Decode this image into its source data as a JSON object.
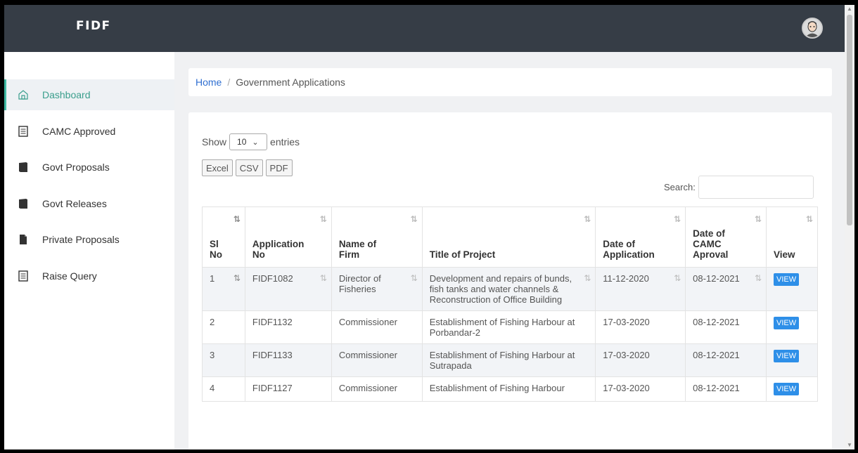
{
  "app": {
    "brand": "FIDF"
  },
  "sidebar": {
    "items": [
      {
        "label": "Dashboard",
        "icon": "home-icon",
        "active": true
      },
      {
        "label": "CAMC Approved",
        "icon": "list-icon"
      },
      {
        "label": "Govt Proposals",
        "icon": "book-icon"
      },
      {
        "label": "Govt Releases",
        "icon": "book-icon"
      },
      {
        "label": "Private Proposals",
        "icon": "file-icon"
      },
      {
        "label": "Raise Query",
        "icon": "list-icon"
      }
    ]
  },
  "breadcrumb": {
    "home": "Home",
    "separator": "/",
    "current": "Government Applications"
  },
  "table_controls": {
    "show_label": "Show",
    "entries_value": "10",
    "entries_label": "entries",
    "buttons": [
      "Excel",
      "CSV",
      "PDF"
    ],
    "search_label": "Search:",
    "search_value": ""
  },
  "table": {
    "headers": [
      {
        "l1": "Sl",
        "l2": "No"
      },
      {
        "l1": "Application",
        "l2": "No"
      },
      {
        "l1": "Name of",
        "l2": "Firm"
      },
      {
        "l1": "",
        "l2": "Title of Project"
      },
      {
        "l1": "Date of",
        "l2": "Application"
      },
      {
        "l1": "Date of",
        "l1b": "CAMC",
        "l2": "Aproval"
      },
      {
        "l1": "",
        "l2": "View"
      }
    ],
    "rows": [
      {
        "sl": "1",
        "app_no": "FIDF1082",
        "firm": "Director of Fisheries",
        "title": "Development and repairs of bunds, fish tanks and water channels & Reconstruction of Office Building",
        "date_app": "11-12-2020",
        "date_camc": "08-12-2021",
        "view": "VIEW"
      },
      {
        "sl": "2",
        "app_no": "FIDF1132",
        "firm": "Commissioner",
        "title": "Establishment of Fishing Harbour at Porbandar-2",
        "date_app": "17-03-2020",
        "date_camc": "08-12-2021",
        "view": "VIEW"
      },
      {
        "sl": "3",
        "app_no": "FIDF1133",
        "firm": "Commissioner",
        "title": "Establishment of Fishing Harbour at Sutrapada",
        "date_app": "17-03-2020",
        "date_camc": "08-12-2021",
        "view": "VIEW"
      },
      {
        "sl": "4",
        "app_no": "FIDF1127",
        "firm": "Commissioner",
        "title": "Establishment of Fishing Harbour",
        "date_app": "17-03-2020",
        "date_camc": "08-12-2021",
        "view": "VIEW"
      }
    ]
  },
  "colors": {
    "topbar": "#363d46",
    "accent": "#3fb9a3",
    "link": "#2f6fd1",
    "view_button": "#2e8fe8"
  }
}
